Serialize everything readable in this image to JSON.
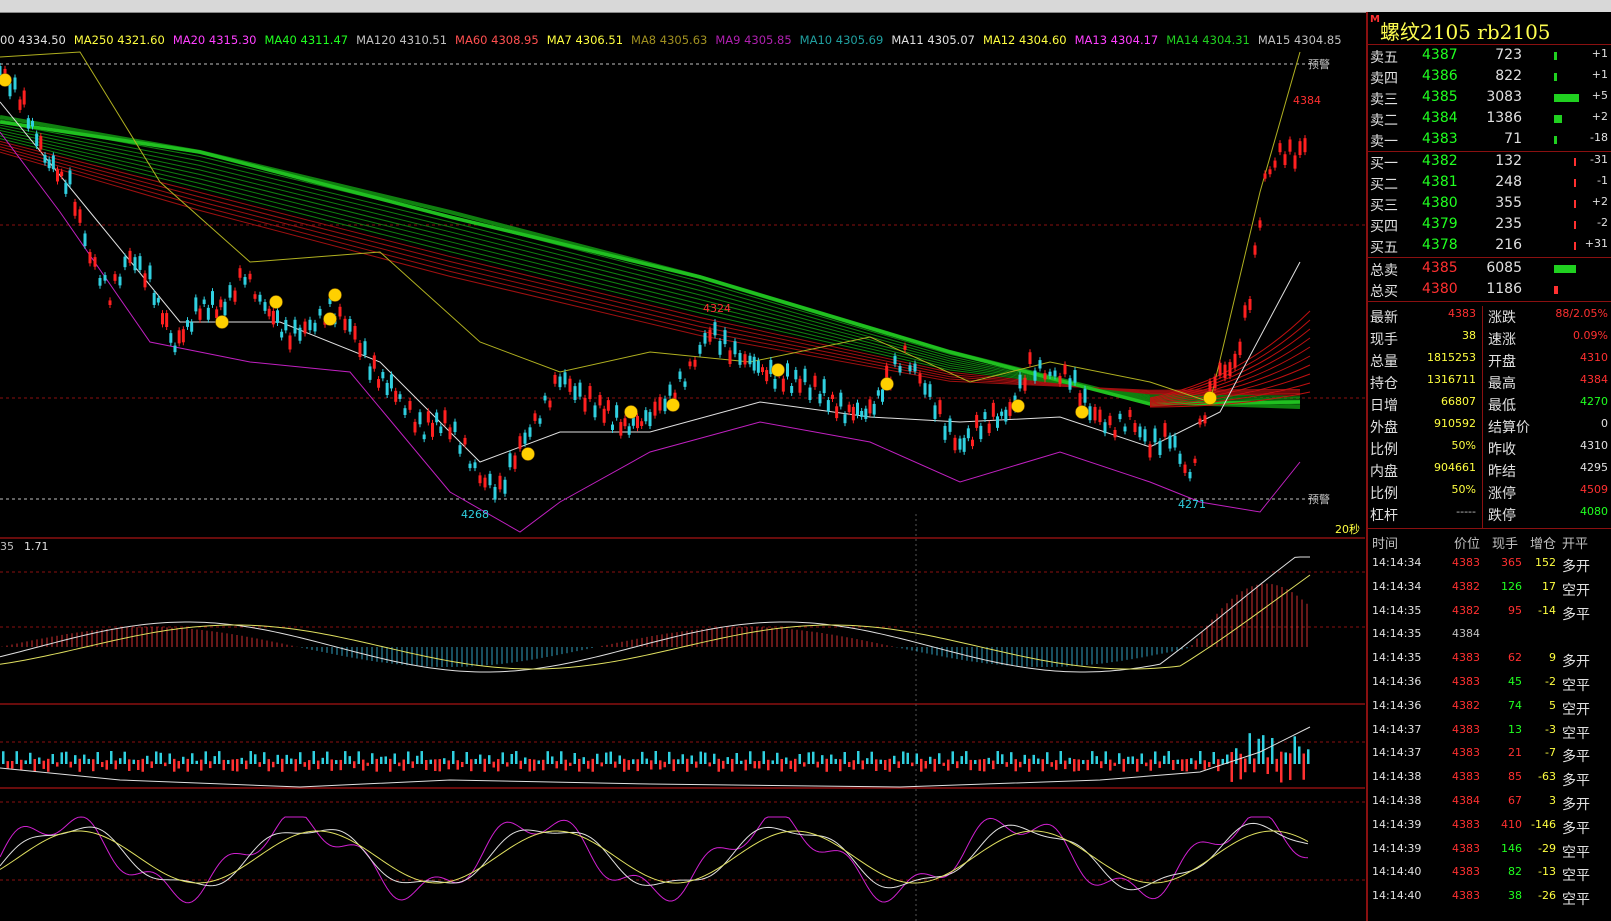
{
  "window": {
    "title": "螺纹2105 rb2105",
    "marker": "M"
  },
  "ma_legend": [
    {
      "label": "00 4334.50",
      "color": "#e0e0e0"
    },
    {
      "label": "MA250 4321.60",
      "color": "#ffff40"
    },
    {
      "label": "MA20 4315.30",
      "color": "#ff40ff"
    },
    {
      "label": "MA40 4311.47",
      "color": "#20ff20"
    },
    {
      "label": "MA120 4310.51",
      "color": "#c0c0c0"
    },
    {
      "label": "MA60 4308.95",
      "color": "#ff5050"
    },
    {
      "label": "MA7 4306.51",
      "color": "#ffff40"
    },
    {
      "label": "MA8 4305.63",
      "color": "#a09020"
    },
    {
      "label": "MA9 4305.85",
      "color": "#b020b0"
    },
    {
      "label": "MA10 4305.69",
      "color": "#20a0a0"
    },
    {
      "label": "MA11 4305.07",
      "color": "#e0e0e0"
    },
    {
      "label": "MA12 4304.60",
      "color": "#ffff40"
    },
    {
      "label": "MA13 4304.17",
      "color": "#ff40ff"
    },
    {
      "label": "MA14 4304.31",
      "color": "#20d020"
    },
    {
      "label": "MA15 4304.85",
      "color": "#c0c0c0"
    }
  ],
  "chart": {
    "alert_top": "预警",
    "alert_bottom": "预警",
    "high_label": "4384",
    "mid_high_label": "4324",
    "low_label_1": "4268",
    "low_label_2": "4271",
    "interval_label": "20秒",
    "macd_label_a": "35",
    "macd_label_b": "1.71"
  },
  "order_book": {
    "asks": [
      {
        "label": "卖五",
        "price": "4387",
        "vol": "723",
        "chg": "+1",
        "bar": 0.1
      },
      {
        "label": "卖四",
        "price": "4386",
        "vol": "822",
        "chg": "+1",
        "bar": 0.1
      },
      {
        "label": "卖三",
        "price": "4385",
        "vol": "3083",
        "chg": "+5",
        "bar": 0.9
      },
      {
        "label": "卖二",
        "price": "4384",
        "vol": "1386",
        "chg": "+2",
        "bar": 0.3
      },
      {
        "label": "卖一",
        "price": "4383",
        "vol": "71",
        "chg": "-18",
        "bar": 0.02
      }
    ],
    "bids": [
      {
        "label": "买一",
        "price": "4382",
        "vol": "132",
        "chg": "-31",
        "bar": 0.05
      },
      {
        "label": "买二",
        "price": "4381",
        "vol": "248",
        "chg": "-1",
        "bar": 0.05
      },
      {
        "label": "买三",
        "price": "4380",
        "vol": "355",
        "chg": "+2",
        "bar": 0.05
      },
      {
        "label": "买四",
        "price": "4379",
        "vol": "235",
        "chg": "-2",
        "bar": 0.05
      },
      {
        "label": "买五",
        "price": "4378",
        "vol": "216",
        "chg": "+31",
        "bar": 0.05
      }
    ],
    "total_sell": {
      "label": "总卖",
      "price": "4385",
      "vol": "6085",
      "bar": 0.8
    },
    "total_buy": {
      "label": "总买",
      "price": "4380",
      "vol": "1186",
      "bar": 0.15
    }
  },
  "stats": [
    {
      "l1": "最新",
      "v1": "4383",
      "c1": "r",
      "l2": "涨跌",
      "v2": "88/2.05%",
      "c2": "r"
    },
    {
      "l1": "现手",
      "v1": "38",
      "c1": "y",
      "l2": "速涨",
      "v2": "0.09%",
      "c2": "r"
    },
    {
      "l1": "总量",
      "v1": "1815253",
      "c1": "y",
      "l2": "开盘",
      "v2": "4310",
      "c2": "r"
    },
    {
      "l1": "持仓",
      "v1": "1316711",
      "c1": "y",
      "l2": "最高",
      "v2": "4384",
      "c2": "r"
    },
    {
      "l1": "日增",
      "v1": "66807",
      "c1": "y",
      "l2": "最低",
      "v2": "4270",
      "c2": "g"
    },
    {
      "l1": "外盘",
      "v1": "910592",
      "c1": "y",
      "l2": "结算价",
      "v2": "0",
      "c2": "w"
    },
    {
      "l1": "比例",
      "v1": "50%",
      "c1": "y",
      "l2": "昨收",
      "v2": "4310",
      "c2": "w"
    },
    {
      "l1": "内盘",
      "v1": "904661",
      "c1": "y",
      "l2": "昨结",
      "v2": "4295",
      "c2": "w"
    },
    {
      "l1": "比例",
      "v1": "50%",
      "c1": "y",
      "l2": "涨停",
      "v2": "4509",
      "c2": "r"
    },
    {
      "l1": "杠杆",
      "v1": "-----",
      "c1": "gr",
      "l2": "跌停",
      "v2": "4080",
      "c2": "g"
    }
  ],
  "trades_header": {
    "time": "时间",
    "price": "价位",
    "vol": "现手",
    "oi": "增仓",
    "type": "开平"
  },
  "trades": [
    {
      "time": "14:14:34",
      "price": "4383",
      "vol": "365",
      "oi": "152",
      "type": "多开"
    },
    {
      "time": "14:14:34",
      "price": "4382",
      "vol": "126",
      "oi": "17",
      "type": "空开"
    },
    {
      "time": "14:14:35",
      "price": "4382",
      "vol": "95",
      "oi": "-14",
      "type": "多平"
    },
    {
      "time": "14:14:35",
      "price": "4384",
      "vol": "",
      "oi": "",
      "type": ""
    },
    {
      "time": "14:14:35",
      "price": "4383",
      "vol": "62",
      "oi": "9",
      "type": "多开"
    },
    {
      "time": "14:14:36",
      "price": "4383",
      "vol": "45",
      "oi": "-2",
      "type": "空平"
    },
    {
      "time": "14:14:36",
      "price": "4382",
      "vol": "74",
      "oi": "5",
      "type": "空开"
    },
    {
      "time": "14:14:37",
      "price": "4383",
      "vol": "13",
      "oi": "-3",
      "type": "空平"
    },
    {
      "time": "14:14:37",
      "price": "4383",
      "vol": "21",
      "oi": "-7",
      "type": "多平"
    },
    {
      "time": "14:14:38",
      "price": "4383",
      "vol": "85",
      "oi": "-63",
      "type": "多平"
    },
    {
      "time": "14:14:38",
      "price": "4384",
      "vol": "67",
      "oi": "3",
      "type": "多开"
    },
    {
      "time": "14:14:39",
      "price": "4383",
      "vol": "410",
      "oi": "-146",
      "type": "多平"
    },
    {
      "time": "14:14:39",
      "price": "4383",
      "vol": "146",
      "oi": "-29",
      "type": "空平"
    },
    {
      "time": "14:14:40",
      "price": "4383",
      "vol": "82",
      "oi": "-13",
      "type": "空平"
    },
    {
      "time": "14:14:40",
      "price": "4383",
      "vol": "38",
      "oi": "-26",
      "type": "空平"
    }
  ]
}
